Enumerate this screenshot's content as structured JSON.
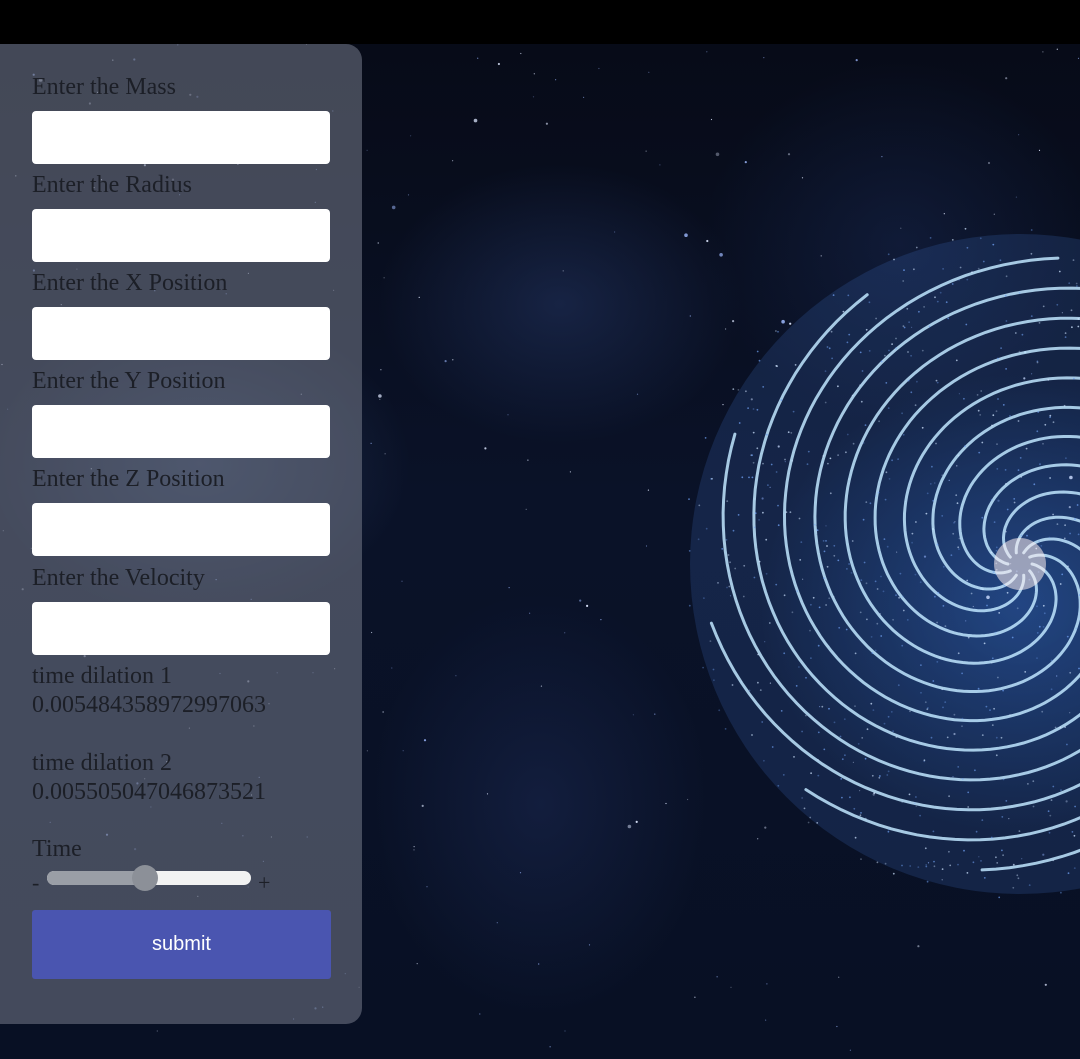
{
  "form": {
    "fields": [
      {
        "label": "Enter the Mass",
        "value": "",
        "placeholder": ""
      },
      {
        "label": "Enter the Radius",
        "value": "",
        "placeholder": ""
      },
      {
        "label": "Enter the X Position",
        "value": "",
        "placeholder": ""
      },
      {
        "label": "Enter the Y Position",
        "value": "",
        "placeholder": ""
      },
      {
        "label": "Enter the Z Position",
        "value": "",
        "placeholder": ""
      },
      {
        "label": "Enter the Velocity",
        "value": "",
        "placeholder": ""
      }
    ],
    "time_dilation_1": {
      "label": "time dilation 1",
      "value": "0.005484358972997063"
    },
    "time_dilation_2": {
      "label": "time dilation 2",
      "value": "0.005505047046873521"
    },
    "time_slider": {
      "label": "Time",
      "minus": "-",
      "plus": "+",
      "value_percent": 48
    },
    "submit_label": "submit"
  },
  "colors": {
    "panel_bg": "#70768594",
    "button_bg": "#4a55b0",
    "spiral": "#bfe6ff",
    "space_bg": "#0a1228"
  }
}
